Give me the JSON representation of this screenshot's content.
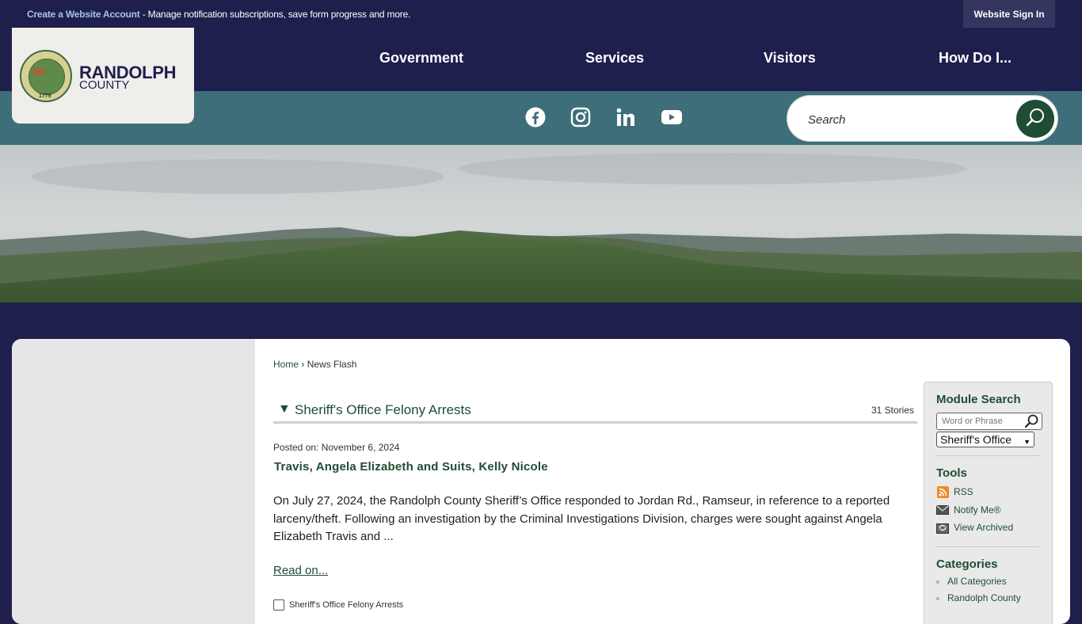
{
  "top_bar": {
    "create_account_link": "Create a Website Account",
    "create_account_text": " - Manage notification subscriptions, save form progress and more.",
    "sign_in": "Website Sign In"
  },
  "logo": {
    "name": "RANDOLPH",
    "sub": "COUNTY",
    "seal_year": "1779"
  },
  "nav": {
    "items": [
      "Government",
      "Services",
      "Visitors",
      "How Do I..."
    ]
  },
  "social": [
    "facebook-icon",
    "instagram-icon",
    "linkedin-icon",
    "youtube-icon"
  ],
  "search": {
    "placeholder": "Search"
  },
  "breadcrumb": {
    "home": "Home",
    "sep": "›",
    "current": "News Flash"
  },
  "category": {
    "title": "Sheriff's Office Felony Arrests",
    "count": "31 Stories"
  },
  "story": {
    "posted": "Posted on: November 6, 2024",
    "title": "Travis, Angela Elizabeth and Suits, Kelly Nicole",
    "body": "On July 27, 2024, the Randolph County Sheriff’s Office responded to Jordan Rd., Ramseur, in reference to a reported larceny/theft. Following an investigation by the Criminal Investigations Division, charges were sought against Angela Elizabeth Travis and ...",
    "read_on": "Read on...",
    "checkbox_label": "Sheriff's Office Felony Arrests"
  },
  "sidebar": {
    "module_search_heading": "Module Search",
    "search_placeholder": "Word or Phrase",
    "select_value": "Sheriff's Office",
    "tools_heading": "Tools",
    "tools": [
      "RSS",
      "Notify Me®",
      "View Archived"
    ],
    "categories_heading": "Categories",
    "categories": [
      "All Categories",
      "Randolph County"
    ]
  }
}
